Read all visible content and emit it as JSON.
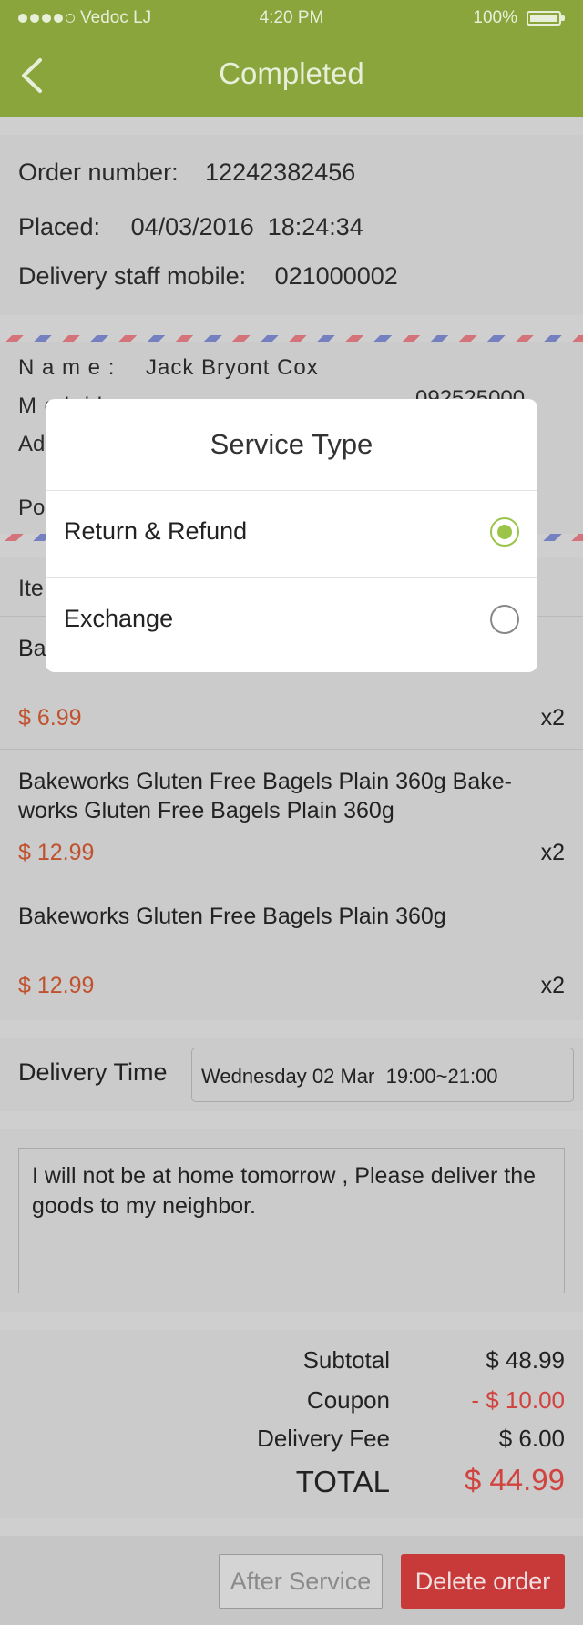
{
  "status_bar": {
    "carrier": "Vedoc LJ",
    "time": "4:20 PM",
    "battery": "100%"
  },
  "header": {
    "title": "Completed"
  },
  "order": {
    "number_label": "Order number:",
    "number": "12242382456",
    "placed_label": "Placed:",
    "placed": "04/03/2016  18:24:34",
    "staff_label": "Delivery staff mobile:",
    "staff": "021000002"
  },
  "address": {
    "name_label": "N a m e :",
    "name": "Jack Bryont Cox",
    "mobile_label": "M o b i l e",
    "phone_partial": "092525000",
    "address_label": "Ad",
    "postcode_label": "Po"
  },
  "items": {
    "header": "Ite",
    "list": [
      {
        "name": "Ba",
        "price": "$ 6.99",
        "qty": "x2"
      },
      {
        "name": "Bakeworks Gluten Free Bagels Plain 360g Bake-works Gluten Free Bagels Plain 360g",
        "price": "$ 12.99",
        "qty": "x2"
      },
      {
        "name": "Bakeworks Gluten Free Bagels Plain 360g",
        "price": "$ 12.99",
        "qty": "x2"
      }
    ]
  },
  "delivery": {
    "label": "Delivery Time",
    "value": "Wednesday 02 Mar  19:00~21:00"
  },
  "note": {
    "text": "I will not be at home tomorrow , Please deliver the goods to my neighbor."
  },
  "summary": {
    "subtotal_label": "Subtotal",
    "subtotal": "$ 48.99",
    "coupon_label": "Coupon",
    "coupon": "- $ 10.00",
    "fee_label": "Delivery Fee",
    "fee": "$ 6.00",
    "total_label": "TOTAL",
    "total": "$ 44.99"
  },
  "buttons": {
    "after_service": "After Service",
    "delete_order": "Delete order"
  },
  "modal": {
    "title": "Service Type",
    "options": [
      {
        "label": "Return & Refund",
        "selected": true
      },
      {
        "label": "Exchange",
        "selected": false
      }
    ]
  },
  "colors": {
    "accent": "#89a53c",
    "price": "#c0522e",
    "danger": "#c83a3a",
    "radio": "#9bc449"
  }
}
